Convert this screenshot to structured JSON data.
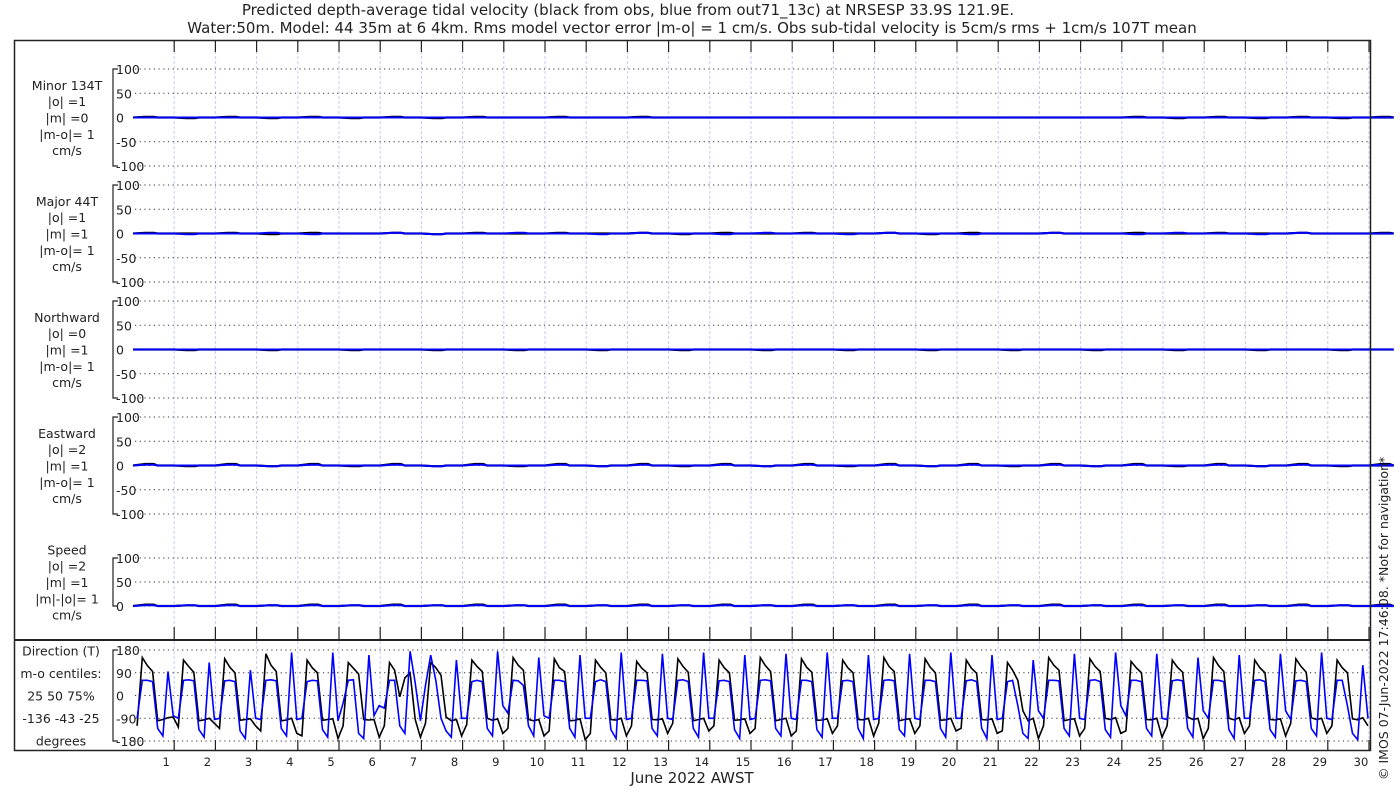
{
  "title": [
    "Predicted depth-average tidal velocity (black from obs, blue from out71_13c) at NRSESP 33.9S 121.9E.",
    "Water:50m. Model: 44 35m at 6 4km. Rms model vector error |m-o| = 1 cm/s. Obs sub-tidal velocity is 5cm/s rms + 1cm/s 107T mean"
  ],
  "xlabel": "June 2022 AWST",
  "copyright": "© IMOS 07-Jun-2022 17:46:08. *Not for navigation*",
  "colors": {
    "obs": "#000000",
    "model": "#0000ff",
    "day_grid": "#c8cdf0"
  },
  "chart_data": {
    "type": "line",
    "x_ticks": [
      1,
      2,
      3,
      4,
      5,
      6,
      7,
      8,
      9,
      10,
      11,
      12,
      13,
      14,
      15,
      16,
      17,
      18,
      19,
      20,
      21,
      22,
      23,
      24,
      25,
      26,
      27,
      28,
      29,
      30
    ],
    "xlim": [
      0,
      30.05
    ],
    "grid": true,
    "panels": [
      {
        "labels": [
          "Minor 134T",
          "|o| =1",
          "|m| =0",
          "|m-o|= 1",
          "cm/s"
        ],
        "yticks": [
          100,
          50,
          0,
          -50,
          -100
        ],
        "ylim": [
          -100,
          100
        ],
        "obs_daily": [
          1,
          -1,
          1,
          -1,
          1,
          -1,
          1,
          -1,
          1,
          0,
          1,
          0,
          1,
          0,
          0,
          0,
          0,
          0,
          0,
          0,
          0,
          0,
          0,
          0,
          1,
          -1,
          1,
          -1,
          1,
          -1,
          1
        ],
        "model_daily": [
          0,
          0,
          0,
          0,
          0,
          0,
          0,
          0,
          0,
          0,
          0,
          0,
          0,
          0,
          0,
          0,
          0,
          0,
          0,
          0,
          0,
          0,
          0,
          0,
          0,
          0,
          0,
          0,
          0,
          0,
          0
        ]
      },
      {
        "labels": [
          "Major 44T",
          "|o| =1",
          "|m| =1",
          "|m-o|= 1",
          "cm/s"
        ],
        "yticks": [
          100,
          50,
          0,
          -50,
          -100
        ],
        "ylim": [
          -100,
          100
        ],
        "obs_daily": [
          1,
          0,
          1,
          -1,
          1,
          0,
          1,
          -1,
          1,
          0,
          1,
          0,
          1,
          -1,
          1,
          0,
          1,
          0,
          1,
          -1,
          1,
          0,
          1,
          0,
          1,
          0,
          1,
          0,
          1,
          0,
          1
        ],
        "model_daily": [
          0,
          -1,
          0,
          1,
          -1,
          0,
          1,
          -1,
          0,
          1,
          0,
          -1,
          1,
          0,
          -1,
          1,
          0,
          -1,
          1,
          0,
          -1,
          0,
          1,
          0,
          -1,
          1,
          0,
          -1,
          1,
          0,
          0
        ]
      },
      {
        "labels": [
          "Northward",
          "|o| =0",
          "|m| =1",
          "|m-o|= 1",
          "cm/s"
        ],
        "yticks": [
          100,
          50,
          0,
          -50,
          -100
        ],
        "ylim": [
          -100,
          100
        ],
        "obs_daily": [
          0,
          -1,
          0,
          -1,
          0,
          -1,
          0,
          -1,
          0,
          -1,
          0,
          -1,
          0,
          -1,
          0,
          -1,
          0,
          -1,
          0,
          -1,
          0,
          -1,
          0,
          -1,
          0,
          -1,
          0,
          -1,
          0,
          -1,
          0
        ],
        "model_daily": [
          0,
          0,
          0,
          0,
          0,
          0,
          0,
          0,
          0,
          0,
          0,
          0,
          0,
          0,
          0,
          0,
          0,
          0,
          0,
          0,
          0,
          0,
          0,
          0,
          0,
          0,
          0,
          0,
          0,
          0,
          0
        ]
      },
      {
        "labels": [
          "Eastward",
          "|o| =2",
          "|m| =1",
          "|m-o|= 1",
          "cm/s"
        ],
        "yticks": [
          100,
          50,
          0,
          -50,
          -100
        ],
        "ylim": [
          -100,
          100
        ],
        "obs_daily": [
          2,
          -1,
          2,
          -1,
          2,
          -1,
          2,
          -1,
          2,
          -1,
          2,
          -1,
          2,
          -1,
          2,
          -1,
          2,
          -1,
          2,
          -1,
          2,
          -1,
          2,
          -1,
          2,
          -1,
          2,
          -1,
          2,
          -1,
          2
        ],
        "model_daily": [
          1,
          0,
          1,
          -1,
          1,
          0,
          1,
          -1,
          1,
          0,
          1,
          -1,
          1,
          0,
          1,
          -1,
          1,
          0,
          1,
          -1,
          1,
          0,
          1,
          -1,
          1,
          0,
          1,
          -1,
          1,
          0,
          1
        ]
      },
      {
        "labels": [
          "Speed",
          "|o| =2",
          "|m| =1",
          "|m|-|o|= 1",
          "cm/s"
        ],
        "yticks": [
          100,
          50,
          0
        ],
        "ylim": [
          0,
          100
        ],
        "obs_daily": [
          2,
          1,
          2,
          1,
          2,
          1,
          2,
          1,
          2,
          1,
          2,
          1,
          2,
          1,
          2,
          1,
          2,
          1,
          2,
          1,
          2,
          1,
          2,
          1,
          2,
          1,
          2,
          1,
          2,
          1,
          2
        ],
        "model_daily": [
          1,
          1,
          1,
          1,
          1,
          1,
          1,
          1,
          1,
          1,
          1,
          1,
          1,
          1,
          1,
          1,
          1,
          1,
          1,
          1,
          1,
          1,
          1,
          1,
          1,
          1,
          1,
          1,
          1,
          1,
          1
        ]
      }
    ],
    "direction": {
      "labels": [
        "Direction (T)",
        "m-o centiles:",
        "25  50  75%",
        "-136  -43  -25",
        "degrees"
      ],
      "yticks": [
        180,
        90,
        0,
        -90,
        -180
      ],
      "ylim": [
        -180,
        180
      ],
      "sample_hours": 3,
      "obs": [
        -120,
        150,
        118,
        95,
        -100,
        -95,
        -88,
        -85,
        -125,
        140,
        115,
        92,
        -100,
        -96,
        -90,
        -110,
        -130,
        145,
        112,
        90,
        -98,
        -95,
        -92,
        -120,
        -140,
        165,
        120,
        95,
        -100,
        -97,
        -90,
        -150,
        -160,
        140,
        110,
        90,
        -98,
        -95,
        -92,
        -170,
        -120,
        130,
        108,
        85,
        -95,
        -97,
        -95,
        -165,
        -120,
        130,
        100,
        -5,
        70,
        90,
        -95,
        -165,
        -110,
        130,
        110,
        80,
        -85,
        -100,
        -95,
        -160,
        -115,
        140,
        115,
        95,
        -90,
        -98,
        -92,
        -150,
        -130,
        150,
        120,
        100,
        -95,
        -100,
        -95,
        -160,
        -140,
        145,
        110,
        95,
        -100,
        -98,
        -92,
        -175,
        -150,
        140,
        112,
        90,
        -95,
        -97,
        -90,
        -160,
        -120,
        135,
        108,
        90,
        -95,
        -96,
        -92,
        -150,
        -110,
        145,
        115,
        92,
        -100,
        -95,
        -90,
        -140,
        -120,
        140,
        110,
        90,
        -98,
        -96,
        -92,
        -150,
        -130,
        150,
        118,
        95,
        -100,
        -95,
        -90,
        -160,
        -140,
        145,
        112,
        92,
        -98,
        -97,
        -92,
        -150,
        -120,
        140,
        110,
        90,
        -95,
        -96,
        -90,
        -160,
        -110,
        150,
        115,
        95,
        -100,
        -95,
        -92,
        -150,
        -120,
        145,
        112,
        90,
        -98,
        -96,
        -90,
        -140,
        -130,
        140,
        108,
        88,
        -95,
        -97,
        -92,
        -150,
        -140,
        130,
        100,
        60,
        -60,
        -100,
        -90,
        -170,
        -120,
        150,
        120,
        100,
        -100,
        -95,
        -92,
        -160,
        -130,
        145,
        115,
        95,
        -90,
        -95,
        -88,
        -150,
        -140,
        135,
        110,
        90,
        -95,
        -96,
        -90,
        -165,
        -120,
        140,
        112,
        92,
        -85,
        -95,
        -90,
        -170,
        -130,
        150,
        118,
        95,
        -90,
        -96,
        -88,
        -150,
        -120,
        140,
        110,
        90,
        -95,
        -97,
        -92,
        -160,
        -110,
        145,
        115,
        92,
        -88,
        -95,
        -90,
        -150,
        -120,
        140,
        110,
        90,
        -92,
        -96,
        -88,
        -120
      ],
      "model": [
        -90,
        60,
        60,
        55,
        -130,
        -160,
        95,
        -80,
        -90,
        60,
        62,
        58,
        -135,
        -165,
        130,
        -95,
        -90,
        58,
        60,
        55,
        -140,
        -170,
        100,
        -90,
        -95,
        60,
        62,
        58,
        -130,
        -160,
        170,
        -95,
        -90,
        55,
        60,
        58,
        -135,
        -165,
        170,
        -100,
        -30,
        60,
        62,
        -150,
        -170,
        160,
        -80,
        -40,
        -50,
        60,
        60,
        -120,
        -150,
        175,
        50,
        -100,
        40,
        160,
        60,
        -90,
        -140,
        -165,
        140,
        -90,
        -90,
        55,
        60,
        55,
        -130,
        -160,
        175,
        -40,
        -70,
        60,
        58,
        40,
        -120,
        -160,
        150,
        -80,
        -90,
        60,
        60,
        55,
        -130,
        -165,
        160,
        -90,
        -90,
        55,
        62,
        55,
        -135,
        -170,
        170,
        -95,
        -90,
        60,
        60,
        58,
        -130,
        -160,
        165,
        -90,
        -95,
        60,
        62,
        55,
        -130,
        -165,
        170,
        -90,
        -90,
        58,
        60,
        55,
        -135,
        -170,
        160,
        -95,
        -90,
        60,
        62,
        58,
        -130,
        -160,
        165,
        -90,
        -95,
        60,
        60,
        55,
        -135,
        -165,
        170,
        -90,
        -90,
        58,
        60,
        55,
        -130,
        -170,
        160,
        -95,
        -90,
        60,
        62,
        58,
        -135,
        -160,
        165,
        -90,
        -95,
        60,
        60,
        55,
        -130,
        -165,
        170,
        -90,
        -90,
        58,
        62,
        55,
        -130,
        -170,
        160,
        -95,
        -90,
        55,
        60,
        -40,
        -150,
        -170,
        140,
        -60,
        -90,
        60,
        60,
        58,
        -130,
        -160,
        165,
        -90,
        -95,
        60,
        62,
        55,
        -135,
        -165,
        170,
        -40,
        -80,
        60,
        60,
        55,
        -130,
        -160,
        165,
        -90,
        -95,
        58,
        62,
        58,
        -130,
        -165,
        150,
        -60,
        -90,
        60,
        60,
        55,
        -135,
        -170,
        160,
        -90,
        -90,
        60,
        62,
        55,
        -135,
        -165,
        165,
        -60,
        -95,
        58,
        60,
        55,
        -130,
        -160,
        170,
        -90,
        -95,
        60,
        60,
        -40,
        -150,
        -175,
        120,
        -90
      ]
    }
  }
}
